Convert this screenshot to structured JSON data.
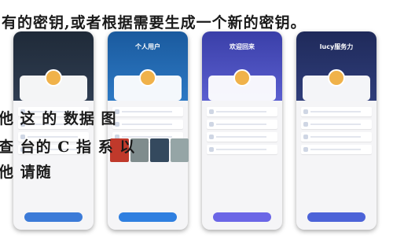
{
  "captions": {
    "line1": "有的密钥,或者根据需要生成一个新的密钥。",
    "line2": "他 这 的 数据 图",
    "line3": "查 台的 C 指 系 以",
    "line4": "他 请随"
  },
  "phones": [
    {
      "title": "",
      "subtitle": "",
      "status_time": "",
      "status_icons": "",
      "accent": "#2f7fe0"
    },
    {
      "title": "个人用户",
      "subtitle": "",
      "status_time": "",
      "status_icons": "",
      "accent": "#2f7fe0"
    },
    {
      "title": "欢迎回来",
      "subtitle": "",
      "status_time": "",
      "status_icons": "",
      "accent": "#6b66e6"
    },
    {
      "title": "lucy服务力",
      "subtitle": "",
      "status_time": "",
      "status_icons": "",
      "accent": "#4c63d8"
    }
  ],
  "colors": {
    "caption_text": "#1a1a1a",
    "phone1_header": "#1f2a38",
    "phone2_header": "#1a5a9e",
    "phone3_header": "#3a3fa8",
    "phone4_header": "#1f2a5a"
  }
}
